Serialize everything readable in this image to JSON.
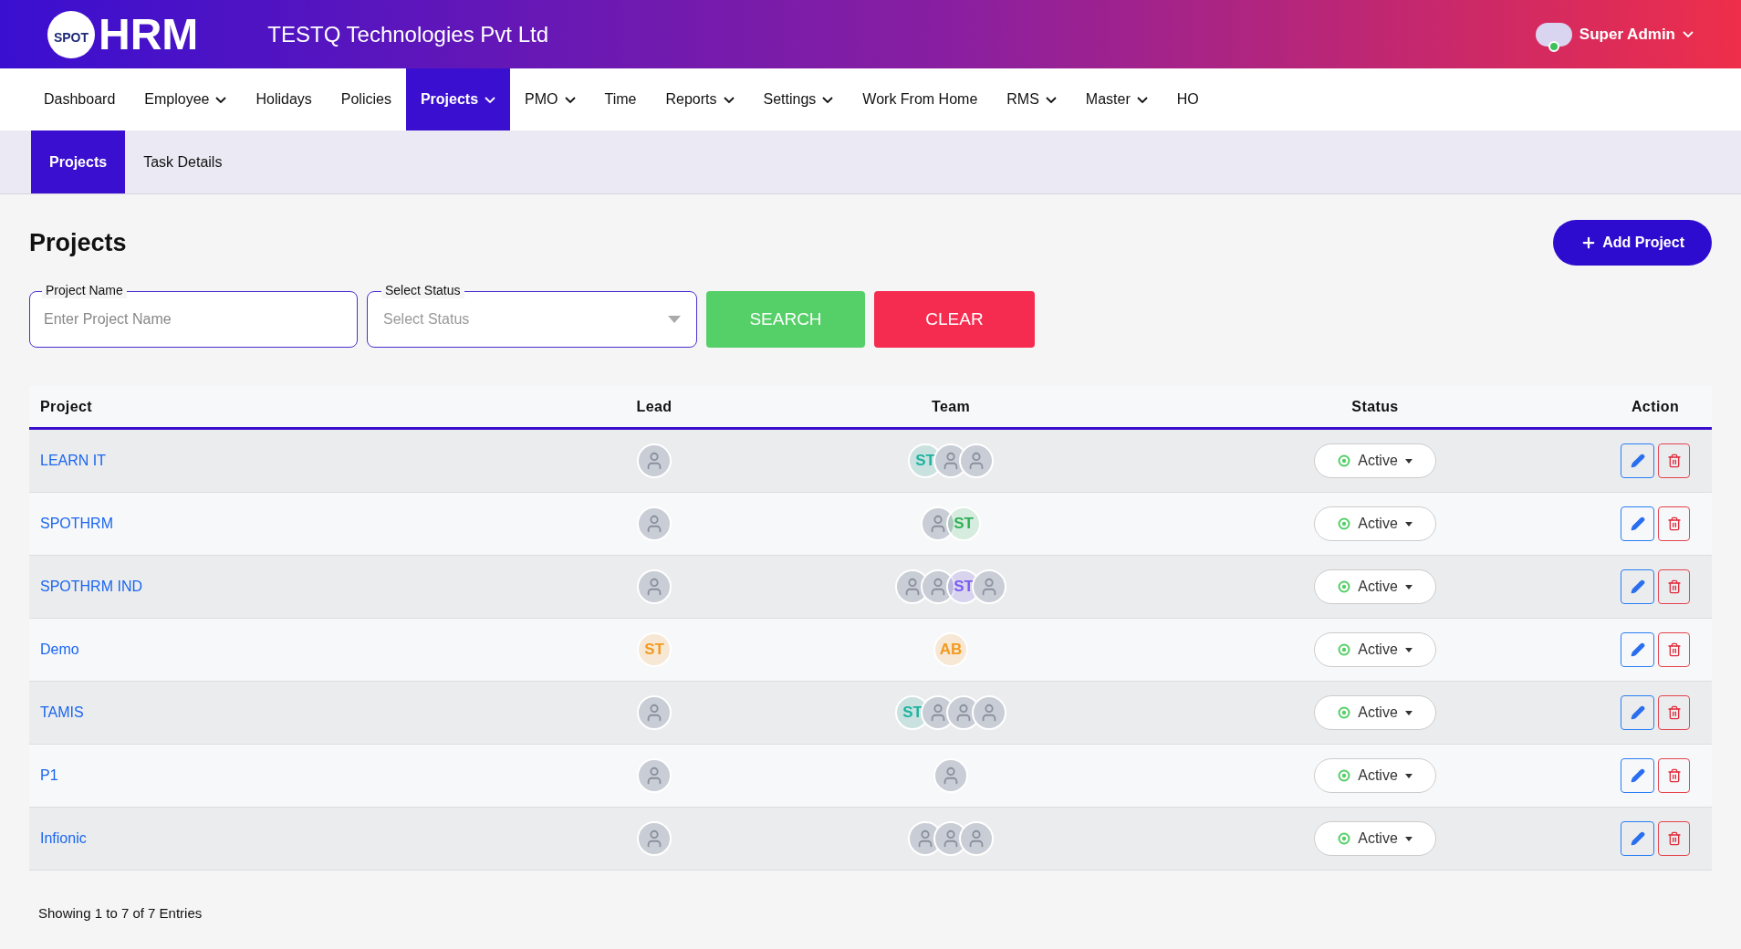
{
  "header": {
    "logo_badge": "SPOT",
    "logo_text": "HRM",
    "company": "TESTQ Technologies Pvt Ltd",
    "user": "Super Admin",
    "online": true
  },
  "nav": [
    {
      "label": "Dashboard",
      "dropdown": false,
      "selected": false
    },
    {
      "label": "Employee",
      "dropdown": true,
      "selected": false
    },
    {
      "label": "Holidays",
      "dropdown": false,
      "selected": false
    },
    {
      "label": "Policies",
      "dropdown": false,
      "selected": false
    },
    {
      "label": "Projects",
      "dropdown": true,
      "selected": true
    },
    {
      "label": "PMO",
      "dropdown": true,
      "selected": false
    },
    {
      "label": "Time",
      "dropdown": false,
      "selected": false
    },
    {
      "label": "Reports",
      "dropdown": true,
      "selected": false
    },
    {
      "label": "Settings",
      "dropdown": true,
      "selected": false
    },
    {
      "label": "Work From Home",
      "dropdown": false,
      "selected": false
    },
    {
      "label": "RMS",
      "dropdown": true,
      "selected": false
    },
    {
      "label": "Master",
      "dropdown": true,
      "selected": false
    },
    {
      "label": "HO",
      "dropdown": false,
      "selected": false
    }
  ],
  "subtabs": [
    {
      "label": "Projects",
      "selected": true
    },
    {
      "label": "Task Details",
      "selected": false
    }
  ],
  "page_title": "Projects",
  "add_button": "Add Project",
  "filters": {
    "project_name": {
      "label": "Project Name",
      "placeholder": "Enter Project Name"
    },
    "status": {
      "label": "Select Status",
      "placeholder": "Select Status"
    },
    "search": "SEARCH",
    "clear": "CLEAR"
  },
  "table": {
    "columns": [
      "Project",
      "Lead",
      "Team",
      "Status",
      "Action"
    ],
    "rows": [
      {
        "project": "LEARN IT",
        "lead": {
          "kind": "photo"
        },
        "team": [
          {
            "kind": "initials",
            "text": "ST",
            "color": "#20b2a0"
          },
          {
            "kind": "photo"
          },
          {
            "kind": "photo"
          }
        ],
        "status": "Active"
      },
      {
        "project": "SPOTHRM",
        "lead": {
          "kind": "photo"
        },
        "team": [
          {
            "kind": "photo"
          },
          {
            "kind": "initials",
            "text": "ST",
            "color": "#2fb157"
          }
        ],
        "status": "Active"
      },
      {
        "project": "SPOTHRM IND",
        "lead": {
          "kind": "photo"
        },
        "team": [
          {
            "kind": "photo"
          },
          {
            "kind": "photo"
          },
          {
            "kind": "initials",
            "text": "ST",
            "color": "#7a5cf0"
          },
          {
            "kind": "photo"
          }
        ],
        "status": "Active"
      },
      {
        "project": "Demo",
        "lead": {
          "kind": "initials",
          "text": "ST",
          "color": "#f39a1f"
        },
        "team": [
          {
            "kind": "initials",
            "text": "AB",
            "color": "#f39a1f"
          }
        ],
        "status": "Active"
      },
      {
        "project": "TAMIS",
        "lead": {
          "kind": "photo"
        },
        "team": [
          {
            "kind": "initials",
            "text": "ST",
            "color": "#20b2a0"
          },
          {
            "kind": "photo"
          },
          {
            "kind": "photo"
          },
          {
            "kind": "photo"
          }
        ],
        "status": "Active"
      },
      {
        "project": "P1",
        "lead": {
          "kind": "photo"
        },
        "team": [
          {
            "kind": "photo"
          }
        ],
        "status": "Active"
      },
      {
        "project": "Infionic",
        "lead": {
          "kind": "photo"
        },
        "team": [
          {
            "kind": "photo"
          },
          {
            "kind": "photo"
          },
          {
            "kind": "photo"
          }
        ],
        "status": "Active"
      }
    ]
  },
  "footer": "Showing 1 to 7 of 7 Entries"
}
